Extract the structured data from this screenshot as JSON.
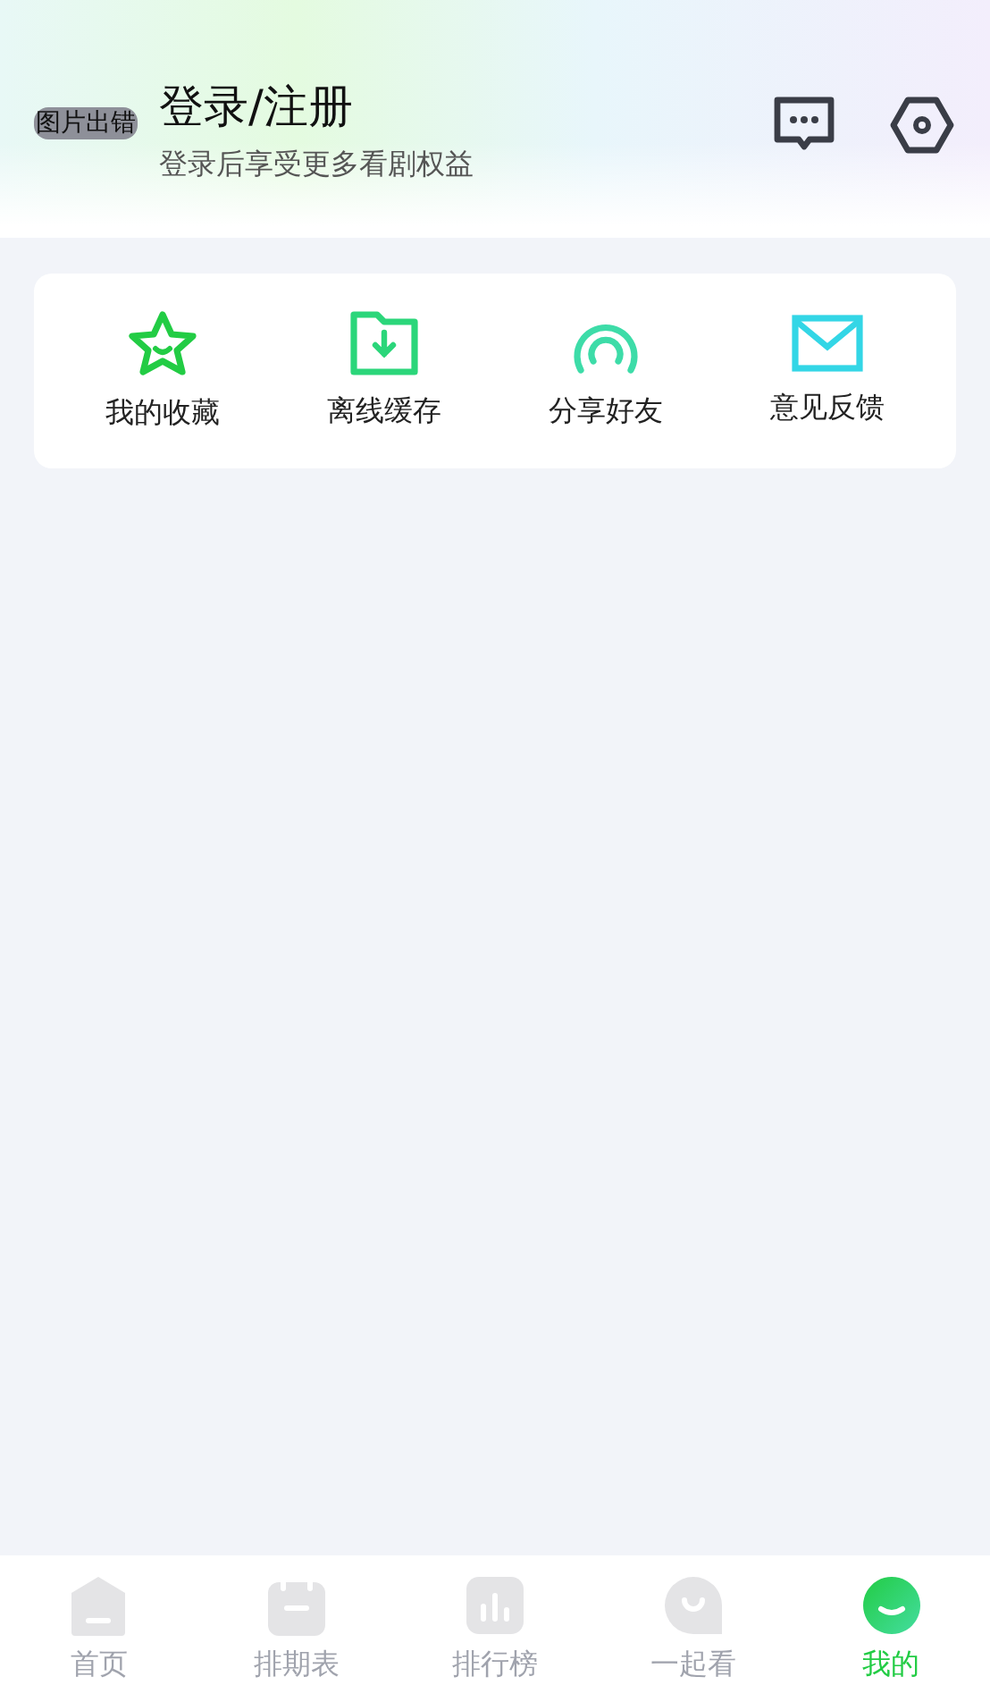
{
  "profile": {
    "avatar_alt": "图片出错",
    "title": "登录/注册",
    "subtitle": "登录后享受更多看剧权益"
  },
  "shortcuts": [
    {
      "label": "我的收藏"
    },
    {
      "label": "离线缓存"
    },
    {
      "label": "分享好友"
    },
    {
      "label": "意见反馈"
    }
  ],
  "tabs": [
    {
      "label": "首页",
      "selected": false
    },
    {
      "label": "排期表",
      "selected": false
    },
    {
      "label": "排行榜",
      "selected": false
    },
    {
      "label": "一起看",
      "selected": false
    },
    {
      "label": "我的",
      "selected": true
    }
  ]
}
